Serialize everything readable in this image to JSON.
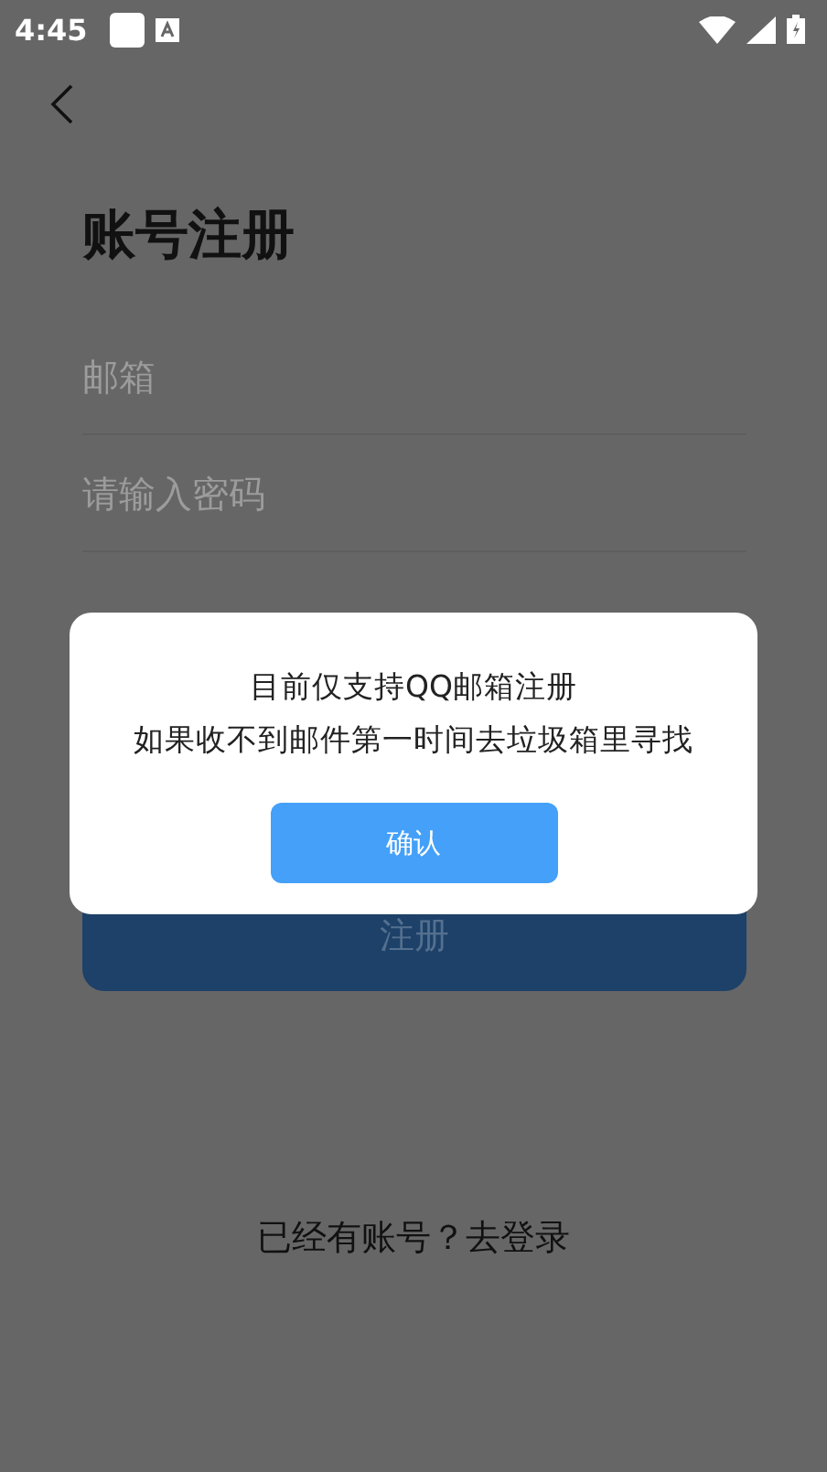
{
  "status_bar": {
    "time": "4:45"
  },
  "title": "账号注册",
  "fields": [
    {
      "placeholder": "邮箱"
    },
    {
      "placeholder": "请输入密码"
    }
  ],
  "register_button": {
    "label": "注册"
  },
  "login_link": {
    "label": "已经有账号？去登录"
  },
  "dialog": {
    "lines": [
      "目前仅支持QQ邮箱注册",
      "如果收不到邮件第一时间去垃圾箱里寻找"
    ],
    "confirm": "确认"
  }
}
